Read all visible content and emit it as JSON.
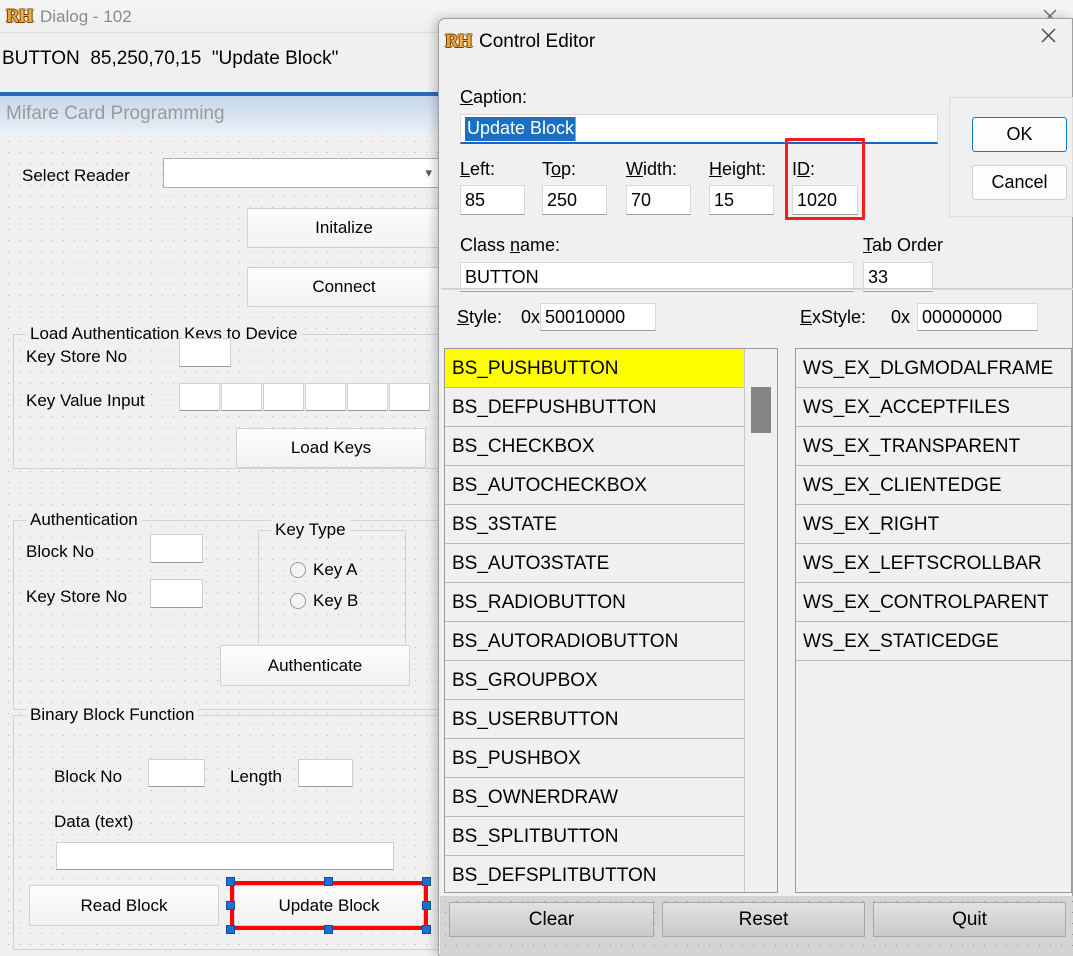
{
  "background_window": {
    "logo": "rh-logo-icon",
    "title": "Dialog - 102",
    "close_icon": "close-icon",
    "resource_line": "BUTTON  85,250,70,15  \"Update Block\"",
    "preview_caption": "Mifare Card Programming",
    "form": {
      "select_reader_label": "Select Reader",
      "reader_combo_value": "",
      "reader_combo_chevron": "chevron-down-icon",
      "initialize_button": "Initalize",
      "connect_button": "Connect",
      "load_keys_group": "Load Authentication Keys to Device",
      "key_store_no_label": "Key Store No",
      "key_store_no_value": "",
      "key_value_input_label": "Key Value Input",
      "key_value_cells": [
        "",
        "",
        "",
        "",
        "",
        ""
      ],
      "load_keys_button": "Load Keys",
      "auth_group": "Authentication",
      "auth_block_no_label": "Block No",
      "auth_block_no_value": "",
      "auth_key_store_no_label": "Key Store No",
      "auth_key_store_no_value": "",
      "key_type_group": "Key Type",
      "key_a_radio": "Key A",
      "key_b_radio": "Key B",
      "authenticate_button": "Authenticate",
      "binary_group": "Binary Block Function",
      "binary_block_no_label": "Block No",
      "binary_block_no_value": "",
      "length_label": "Length",
      "length_value": "",
      "data_text_label": "Data (text)",
      "data_text_value": "",
      "read_block_button": "Read Block",
      "update_block_button": "Update Block"
    }
  },
  "control_editor": {
    "logo": "rh-logo-icon",
    "title": "Control Editor",
    "close_icon": "close-icon",
    "caption_label": "Caption:",
    "caption_value": "Update Block",
    "fields": [
      {
        "label": "Left:",
        "value": "85"
      },
      {
        "label": "Top:",
        "value": "250"
      },
      {
        "label": "Width:",
        "value": "70"
      },
      {
        "label": "Height:",
        "value": "15"
      },
      {
        "label": "ID:",
        "value": "1020"
      }
    ],
    "class_name_label": "Class name:",
    "class_name_value": "BUTTON",
    "tab_order_label": "Tab Order",
    "tab_order_value": "33",
    "style_label": "Style:",
    "style_prefix": "0x",
    "style_value": "50010000",
    "exstyle_label": "ExStyle:",
    "exstyle_prefix": "0x",
    "exstyle_value": "00000000",
    "ok_button": "OK",
    "cancel_button": "Cancel",
    "style_list": [
      "BS_PUSHBUTTON",
      "BS_DEFPUSHBUTTON",
      "BS_CHECKBOX",
      "BS_AUTOCHECKBOX",
      "BS_3STATE",
      "BS_AUTO3STATE",
      "BS_RADIOBUTTON",
      "BS_AUTORADIOBUTTON",
      "BS_GROUPBOX",
      "BS_USERBUTTON",
      "BS_PUSHBOX",
      "BS_OWNERDRAW",
      "BS_SPLITBUTTON",
      "BS_DEFSPLITBUTTON"
    ],
    "style_list_selected_index": 0,
    "exstyle_list": [
      "WS_EX_DLGMODALFRAME",
      "WS_EX_ACCEPTFILES",
      "WS_EX_TRANSPARENT",
      "WS_EX_CLIENTEDGE",
      "WS_EX_RIGHT",
      "WS_EX_LEFTSCROLLBAR",
      "WS_EX_CONTROLPARENT",
      "WS_EX_STATICEDGE"
    ],
    "bottom_buttons": [
      "Clear",
      "Reset",
      "Quit"
    ]
  },
  "colors": {
    "highlight_yellow": "#ffff00",
    "selection_red": "#ff0000",
    "handle_blue": "#1f6fd0",
    "caption_selection_blue": "#1a6fc4",
    "focus_blue": "#1274d4",
    "rule_blue": "#2b6cb5"
  }
}
